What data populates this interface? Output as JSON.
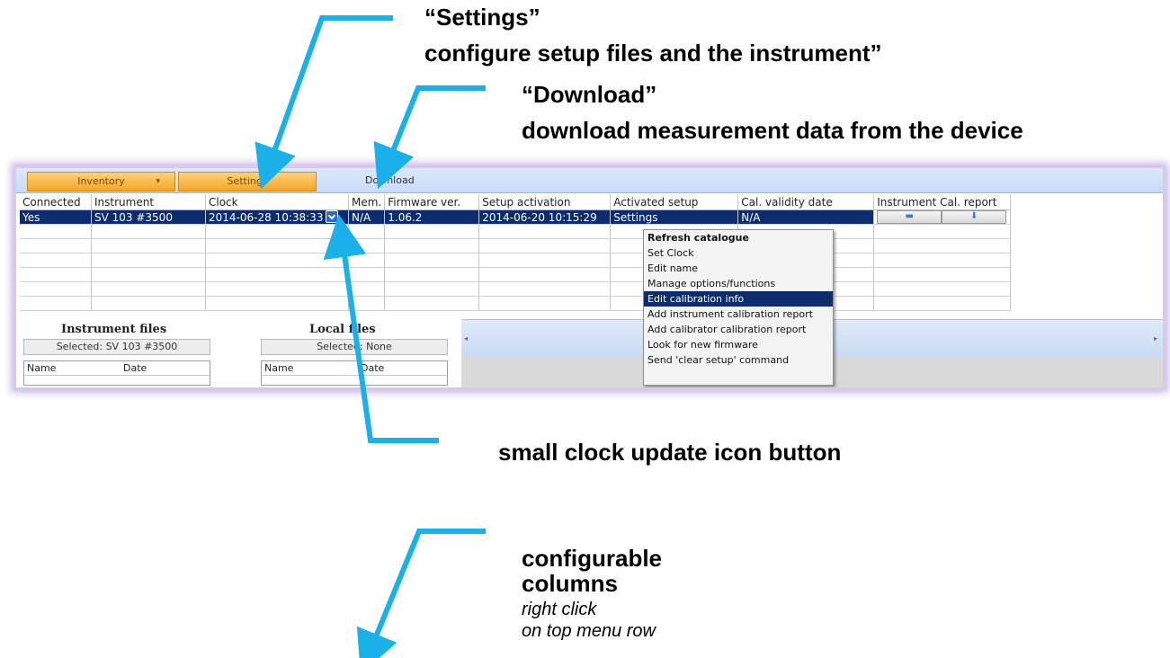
{
  "callouts": {
    "settings_title": "“Settings”",
    "settings_desc": "configure setup files and the instrument”",
    "download_title": "“Download”",
    "download_desc": "download measurement data from the device",
    "clock_icon": "small clock update icon button",
    "columns_line1": "configurable",
    "columns_line2": "columns",
    "columns_sub1": "right click",
    "columns_sub2": "on top menu row"
  },
  "toolbar": {
    "inventory_label": "Inventory",
    "settings_label": "Settings",
    "download_label": "Download"
  },
  "grid": {
    "headers": [
      "Connected",
      "Instrument",
      "Clock",
      "Mem.",
      "Firmware ver.",
      "Setup activation",
      "Activated setup",
      "Cal. validity date",
      "Instrument Cal. report"
    ],
    "row": {
      "connected": "Yes",
      "instrument": "SV 103 #3500",
      "clock": "2014-06-28 10:38:33",
      "mem": "N/A",
      "firmware": "1.06.2",
      "setup_activation": "2014-06-20 10:15:29",
      "activated_setup": "Settings",
      "cal_validity": "N/A"
    }
  },
  "context_menu": {
    "items": [
      "Refresh catalogue",
      "Set Clock",
      "Edit name",
      "Manage options/functions",
      "Edit calibration info",
      "Add instrument calibration report",
      "Add calibrator calibration report",
      "Look for new firmware",
      "Send 'clear setup' command"
    ],
    "highlighted_index": 4
  },
  "instrument_files": {
    "title": "Instrument files",
    "selected": "Selected: SV 103 #3500",
    "col_name": "Name",
    "col_date": "Date"
  },
  "local_files": {
    "title": "Local files",
    "selected": "Selected: None",
    "col_name": "Name",
    "col_date": "Date"
  },
  "colors": {
    "arrow": "#1ab0ea",
    "selection": "#0d2c6e",
    "orange_button": "#f6a526"
  }
}
